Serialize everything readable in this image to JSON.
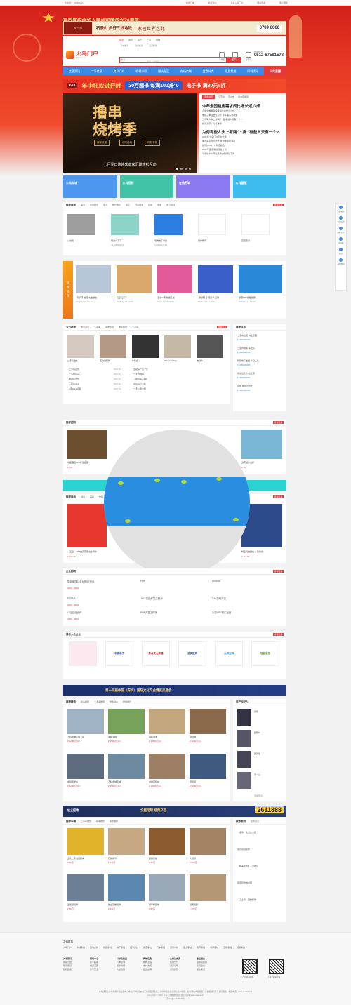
{
  "topbar": {
    "welcome": "欢迎您！ 760846(2)",
    "links": [
      "我的订单",
      "商家中心",
      "手机火鸟门户",
      "网站导航",
      "客户服务"
    ]
  },
  "hero": {
    "title": "热烈庆祝中华人民共和国成立70周年"
  },
  "ad_top": {
    "brand": "中天公馆",
    "slogan": "石景山 步行三线地铁",
    "tagline": "家园世界之北",
    "phone": "6789 6666"
  },
  "header": {
    "logo": "火鸟门户",
    "logo_sub": "fhuoniao.cn",
    "city_tabs": [
      "综合",
      "资讯",
      "房产",
      "二手",
      "团购"
    ],
    "search_groups": [
      "日常推荐",
      "商家推荐",
      "实用推荐"
    ],
    "search_select": "信息",
    "search_placeholder": "请输入关键字",
    "search_button": "搜索",
    "icons": [
      "手机版",
      "微信",
      "小程序"
    ],
    "hotline_label": "客服热线",
    "hotline": "0512-67581578"
  },
  "nav": [
    "信息资讯",
    "二手信息",
    "房产门户",
    "招聘求职",
    "婚庆社区",
    "在线商城",
    "美食外卖",
    "家居频道",
    "同城活动",
    "火鸟直播"
  ],
  "banner618": {
    "tag": "618",
    "big": "年中狂欢进行时",
    "mid": "20万图书 每满100减40",
    "end": "电子书 满20元6折"
  },
  "slider": {
    "big": "撸串\n烧烤季",
    "chips": [
      "商家优惠",
      "汇吃活动",
      "好礼不停"
    ],
    "caption": "七月夏日烧烤季商家汇聚精彩互动"
  },
  "news": {
    "tabs": [
      "头条资讯",
      "江苏省",
      "苏州市",
      "吴中区新闻"
    ],
    "headline1": "今年全国租房需求同比增长近六成",
    "items1": [
      "今年全国租房需求同比增长近六成",
      "重磅三季度会议召开 今年第八次调整",
      "为何有人头上有两个\"旋\"有些人只有一个?",
      "新闻资讯丨今日推荐"
    ],
    "headline2": "为何有些人头上有两个\"旋\" 有些人只有一个?",
    "items2": [
      "2017年火鸟门户平台升级",
      "重庆房企同比增长 发改委最新消息",
      "我们的2017丨年终总结",
      "2017年国家重点研发计划",
      "今年前十个月新房成交量同比下降"
    ]
  },
  "tiles": [
    "火鸟商城",
    "火鸟视频",
    "在线招聘",
    "火鸟直播"
  ],
  "tile_colors": [
    "#4d97f0",
    "#41c3a8",
    "#8a79f0",
    "#3dbcf0"
  ],
  "panel1": {
    "tabs": [
      "推荐商家",
      "美食",
      "休闲娱乐",
      "丽人",
      "婚纱摄影",
      "亲子",
      "汽车服务",
      "结婚",
      "家居",
      "学习培训"
    ],
    "more": "查看更多",
    "items": [
      "八块钱",
      "胡说一下下",
      "瑞鹰电子商务",
      "慧学教育",
      "百强家具"
    ],
    "phones": [
      "",
      "13456789012",
      "17801117123",
      "",
      ""
    ]
  },
  "panel2": {
    "label": "同城活动",
    "items": [
      "【春节】超值大放送啦",
      "红包又来了",
      "活动一览 快报名啦",
      "【优惠】打造个人品牌",
      "星期PPT模板优惠"
    ],
    "dates": [
      "2025-12-25 14:44",
      "2025-12-23 10:00",
      "2025-12-21 09:00",
      "2025-12-19 10:00",
      "2025-12-12 14:00"
    ]
  },
  "panel3": {
    "tabs": [
      "今日推荐",
      "热门资讯",
      "二手车",
      "房屋出租",
      "求职招聘",
      "二手房"
    ],
    "more": "查看更多",
    "items": [
      "二手房出售",
      "美女家装饰",
      "外套女",
      "iPhone 7 32g",
      "电动车"
    ],
    "list_left": [
      "二手房出售",
      "二手iPhone",
      "电动车出售",
      "三星Note4",
      "2手iPad 平板"
    ],
    "list_right": [
      "出租房一室一厅",
      "二手奔驰车",
      "三星Note4手机",
      "iPhone 7 32g",
      "二手公寓出租"
    ],
    "dates": [
      "2017-12",
      "2017-12",
      "2017-12",
      "2017-12",
      "2017-12"
    ]
  },
  "panel3b": {
    "title": "推荐信息",
    "items": [
      "二手房出租 房主直租",
      "二手奔驰车 车况好",
      "精装修房出租 拎包入住",
      "新房出售 价格优惠",
      "招聘 服务员若干"
    ],
    "phone": "13000000000"
  },
  "panel4": {
    "title": "推荐团购",
    "more": "查看更多",
    "items": [
      "悦庭酒店SPA养生会馆",
      "",
      "",
      "",
      "悦府游泳会所"
    ],
    "prices": [
      "¥ 131",
      "",
      "",
      "",
      "¥ 99"
    ]
  },
  "panel5": {
    "tabs": [
      "推荐商品",
      "精选",
      "美妆",
      "数码"
    ],
    "more": "查看更多",
    "items": [
      "【正品】卡尔文克雷恩女士香水",
      "",
      "",
      "",
      "精品机械键盘 多彩背光"
    ],
    "prices": [
      "¥ 232.00",
      "",
      "",
      "",
      "¥ 111.00"
    ]
  },
  "panel6": {
    "title": "企业招聘",
    "more": "查看更多",
    "jobs": [
      [
        "智能家居公平台商城/资深",
        "PHP",
        "Android"
      ],
      [
        "HTML5",
        ".NET高级开发工程师",
        "C++游戏开发"
      ],
      [
        "UI交互设计师",
        "PHP开发工程师",
        "手游APP推广运营"
      ]
    ],
    "salaries": [
      "4000 - 8000",
      "4000 - 8000",
      "4000 - 8000"
    ]
  },
  "panel7": {
    "title": "最新入驻企业",
    "more": "查看更多",
    "logos": [
      "",
      "中澳电子",
      "和合文化传播",
      "浩安医药",
      "太和云网",
      "智能家居"
    ]
  },
  "ad_mid": {
    "text": "第十四届中国（深圳）国际文化产业博览交易会"
  },
  "panel8": {
    "tabs": [
      "推荐楼盘",
      "新房推荐",
      "二手房推荐",
      "楼盘动态",
      "楼盘排行"
    ],
    "items": [
      "万科金域名城 1室",
      "中粮天地",
      "保利领秀",
      "欧陆城"
    ],
    "items2": [
      "中铁德洋鑫",
      "万科金域名城",
      "中铁国际城",
      "碧桂园"
    ],
    "prices": [
      "¥ 12000元/m²",
      "¥ 15000元/m²",
      "¥ 18000元/m²",
      "¥ 9000元/m²"
    ],
    "right_title": "房产经纪人",
    "agents": [
      "张伟",
      "欧阳林",
      "宋天佑",
      "王二小",
      "李大壮"
    ],
    "right_more": "查看更多"
  },
  "ad_bottom": {
    "left": "杭三招聘",
    "mid": "全屋定制 经典产品",
    "phone": "2611888"
  },
  "panel9": {
    "tabs": [
      "推荐车辆",
      "二手车推荐",
      "新车推荐",
      "车友推荐"
    ],
    "items": [
      "出售二手进口跑车",
      "巴黎奢华",
      "欧美风格",
      "大别墅"
    ],
    "items2": [
      "五星级别墅",
      "独立高端别墅",
      "豪华精装修",
      "经典别墅"
    ],
    "prices": [
      "¥ 50万",
      "¥ 130万",
      "¥ 80万",
      "¥ 600万"
    ],
    "right_tabs": [
      "装修案例",
      "装修资讯"
    ],
    "right_items": [
      "【案例】生活在北欧",
      "客厅吊顶装修",
      "【精美装修】三室两厅",
      "卧室装修效果图",
      "【工业风】阁楼装修"
    ]
  },
  "footer": {
    "links_title": "友情链接",
    "links": [
      "火鸟门户",
      "商城系统",
      "团购系统",
      "外卖系统",
      "房产系统",
      "招聘系统",
      "婚庆系统",
      "汽车系统",
      "装修系统",
      "旅游系统",
      "教育系统",
      "商家系统",
      "直播系统",
      "视频系统"
    ],
    "cols": [
      {
        "title": "关于我们",
        "items": [
          "网站介绍",
          "联系我们",
          "隐私政策"
        ]
      },
      {
        "title": "帮助中心",
        "items": [
          "新手指南",
          "常见问题",
          "账号安全"
        ]
      },
      {
        "title": "订单及售后",
        "items": [
          "订单查询",
          "退款说明",
          "售后政策"
        ]
      },
      {
        "title": "购物指南",
        "items": [
          "购物流程",
          "支付方式",
          "配送说明"
        ]
      },
      {
        "title": "支付及发票",
        "items": [
          "在线支付",
          "发票说明",
          "货到付款"
        ]
      },
      {
        "title": "售后服务",
        "items": [
          "退换货政策",
          "投诉建议",
          "服务承诺"
        ]
      }
    ],
    "qr_labels": [
      "扫一扫关注微信",
      "下载手机客户端"
    ],
    "copyright": "本站所有信息均为用户自由发布，本站不对信息的真实性负任何责任，交易时请注意识别信息的真假，如有网站内容侵害了您的权益请联系我们删除，举报电话：0512-67581578",
    "copyright2": "Copyright © 2019 苏州火鸟网络科技有限公司 All rights reserved.",
    "icp": "苏ICP备12345678号"
  },
  "side": [
    "在线客服",
    "意见反馈",
    "商家入驻",
    "手机版",
    "微信",
    "返回顶部"
  ]
}
